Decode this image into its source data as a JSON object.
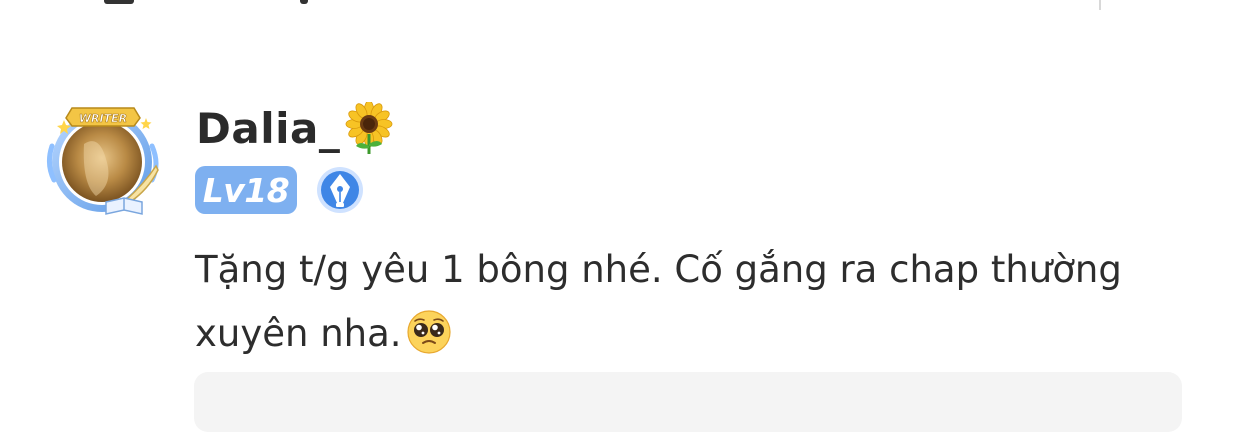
{
  "comment": {
    "username": "Dalia_",
    "level_label": "Lv18",
    "avatar_frame_label": "WRITER",
    "text": "Tặng t/g yêu 1 bông nhé. Cố gắng ra chap thường xuyên nha.",
    "username_emoji": "sunflower-icon",
    "text_emoji": "pleading-face-icon"
  },
  "colors": {
    "level_badge_bg": "#7eb0f0",
    "writer_badge_bg": "#3f86e6",
    "text": "#2d2d2d",
    "reply_box_bg": "#f4f4f4"
  }
}
